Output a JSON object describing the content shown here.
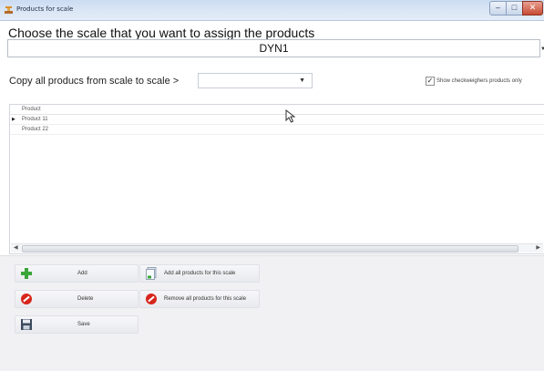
{
  "window": {
    "title": "Products for scale"
  },
  "header": {
    "heading": "Choose the scale that you want to assign the products",
    "scale_value": "DYN1"
  },
  "copy": {
    "label": "Copy all producs from scale to scale >",
    "selected": ""
  },
  "filter": {
    "checkbox_label": "Show checkweighers products only",
    "checked": true
  },
  "grid": {
    "column_header": "Product",
    "rows": [
      {
        "product": "Product 11",
        "current": true
      },
      {
        "product": "Product 22",
        "current": false
      }
    ]
  },
  "actions": {
    "add": "Add",
    "delete": "Delete",
    "save": "Save",
    "add_all": "Add all products for this scale",
    "remove_all": "Remove all products for this scale"
  },
  "icons": {
    "app": "scale-app-icon",
    "add": "plus-icon",
    "delete": "no-entry-icon",
    "save": "floppy-disk-icon",
    "add_all": "document-stack-icon",
    "remove_all": "no-entry-icon"
  },
  "colors": {
    "add_icon": "#3aa63a",
    "delete_icon": "#d8261c",
    "titlebar": "#cbdcf2",
    "close_button": "#c74a33"
  }
}
